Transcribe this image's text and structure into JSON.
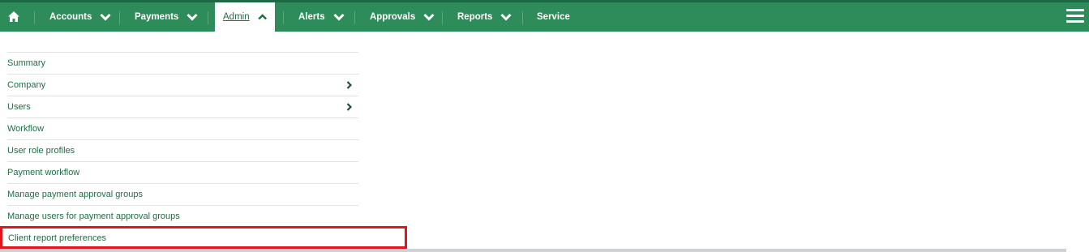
{
  "nav": {
    "home_icon": "home-icon",
    "items": [
      {
        "label": "Accounts",
        "has_chevron": true,
        "chevron": "chevron-down-icon"
      },
      {
        "label": "Payments",
        "has_chevron": true,
        "chevron": "chevron-down-icon"
      },
      {
        "label": "Admin",
        "has_chevron": true,
        "chevron": "chevron-up-icon",
        "active": true
      },
      {
        "label": "Alerts",
        "has_chevron": true,
        "chevron": "chevron-down-icon"
      },
      {
        "label": "Approvals",
        "has_chevron": true,
        "chevron": "chevron-down-icon"
      },
      {
        "label": "Reports",
        "has_chevron": true,
        "chevron": "chevron-down-icon"
      },
      {
        "label": "Service",
        "has_chevron": false
      }
    ],
    "menu_icon": "hamburger-menu-icon"
  },
  "admin_menu": {
    "items": [
      {
        "label": "Summary",
        "has_submenu": false
      },
      {
        "label": "Company",
        "has_submenu": true
      },
      {
        "label": "Users",
        "has_submenu": true
      },
      {
        "label": "Workflow",
        "has_submenu": false
      },
      {
        "label": "User role profiles",
        "has_submenu": false
      },
      {
        "label": "Payment workflow",
        "has_submenu": false
      },
      {
        "label": "Manage payment approval groups",
        "has_submenu": false
      },
      {
        "label": "Manage users for payment approval groups",
        "has_submenu": false
      }
    ],
    "highlighted_item": {
      "label": "Client report preferences"
    }
  },
  "colors": {
    "nav_bg": "#2e8b5a",
    "link": "#1f6f45",
    "highlight_border": "#e0161f"
  }
}
